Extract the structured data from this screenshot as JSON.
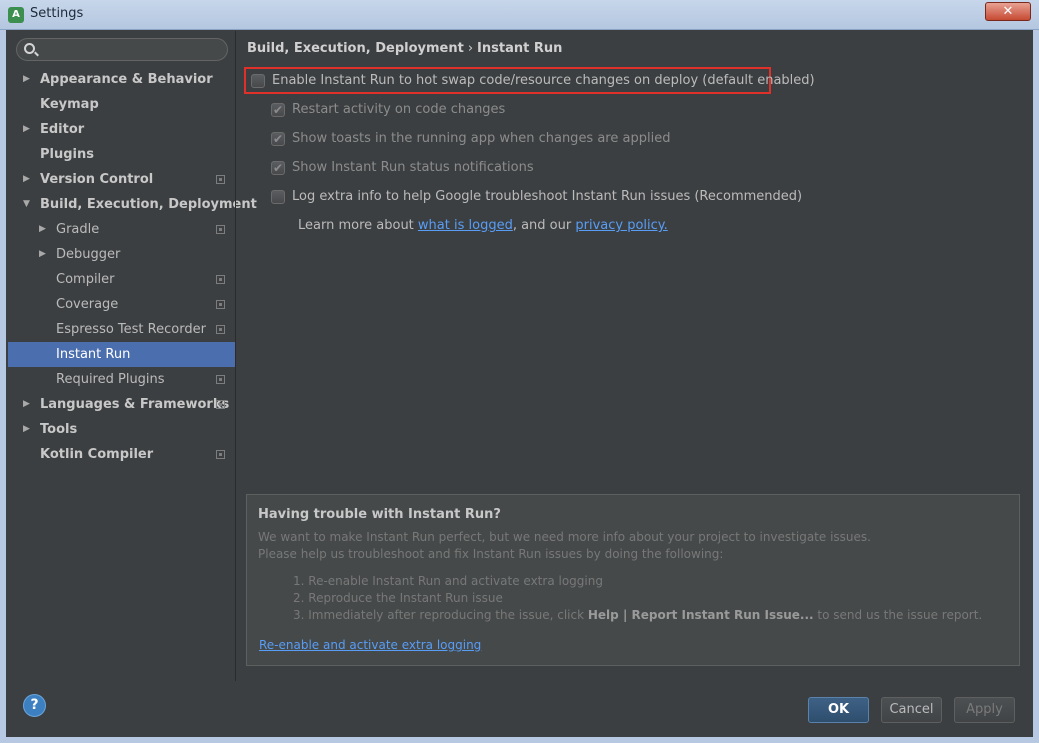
{
  "window": {
    "title": "Settings",
    "close_label": "✕"
  },
  "search": {
    "placeholder": ""
  },
  "sidebar": {
    "items": [
      {
        "label": "Appearance & Behavior"
      },
      {
        "label": "Keymap"
      },
      {
        "label": "Editor"
      },
      {
        "label": "Plugins"
      },
      {
        "label": "Version Control"
      },
      {
        "label": "Build, Execution, Deployment"
      },
      {
        "label": "Gradle"
      },
      {
        "label": "Debugger"
      },
      {
        "label": "Compiler"
      },
      {
        "label": "Coverage"
      },
      {
        "label": "Espresso Test Recorder"
      },
      {
        "label": "Instant Run"
      },
      {
        "label": "Required Plugins"
      },
      {
        "label": "Languages & Frameworks"
      },
      {
        "label": "Tools"
      },
      {
        "label": "Kotlin Compiler"
      }
    ],
    "selected": "Instant Run"
  },
  "breadcrumb": {
    "parent": "Build, Execution, Deployment",
    "separator": "›",
    "current": "Instant Run"
  },
  "options": {
    "enable": {
      "label": "Enable Instant Run to hot swap code/resource changes on deploy (default enabled)",
      "checked": false
    },
    "restart": {
      "label": "Restart activity on code changes",
      "checked": true
    },
    "toasts": {
      "label": "Show toasts in the running app when changes are applied",
      "checked": true
    },
    "status": {
      "label": "Show Instant Run status notifications",
      "checked": true
    },
    "log": {
      "label": "Log extra info to help Google troubleshoot Instant Run issues (Recommended)",
      "checked": false
    }
  },
  "learn_more": {
    "prefix": "Learn more about ",
    "link1": "what is logged",
    "middle": ", and our ",
    "link2": "privacy policy."
  },
  "trouble": {
    "heading": "Having trouble with Instant Run?",
    "line1": "We want to make Instant Run perfect, but we need more info about your project to investigate issues.",
    "line2": "Please help us troubleshoot and fix Instant Run issues by doing the following:",
    "step1": "1. Re-enable Instant Run and activate extra logging",
    "step2": "2. Reproduce the Instant Run issue",
    "step3_prefix": "3. Immediately after reproducing the issue, click ",
    "step3_bold": "Help | Report Instant Run Issue...",
    "step3_suffix": " to send us the issue report.",
    "link": "Re-enable and activate extra logging"
  },
  "buttons": {
    "help": "?",
    "ok": "OK",
    "cancel": "Cancel",
    "apply": "Apply"
  },
  "colors": {
    "selection": "#4b6eaf",
    "link": "#589df6",
    "highlight_border": "#e0302a"
  }
}
